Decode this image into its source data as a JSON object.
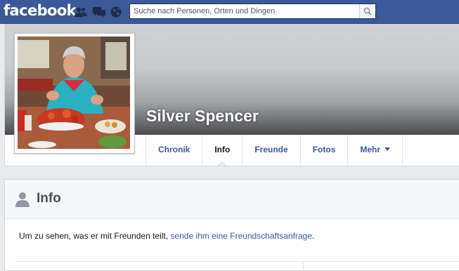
{
  "topbar": {
    "logo": "facebook",
    "search_placeholder": "Suche nach Personen, Orten und Dingen",
    "icons": [
      "friend-requests-icon",
      "messages-icon",
      "notifications-globe-icon",
      "search-icon"
    ]
  },
  "profile": {
    "name": "Silver Spencer"
  },
  "tabs": [
    {
      "label": "Chronik",
      "active": false
    },
    {
      "label": "Info",
      "active": true
    },
    {
      "label": "Freunde",
      "active": false
    },
    {
      "label": "Fotos",
      "active": false
    },
    {
      "label": "Mehr",
      "active": false
    }
  ],
  "info": {
    "title": "Info",
    "text_before": "Um zu sehen, was er mit Freunden teilt, ",
    "link_text": "sende ihm eine Freundschaftsanfrage",
    "text_after": "."
  },
  "colors": {
    "brand_blue": "#3b5998",
    "page_bg": "#e9eaed"
  }
}
